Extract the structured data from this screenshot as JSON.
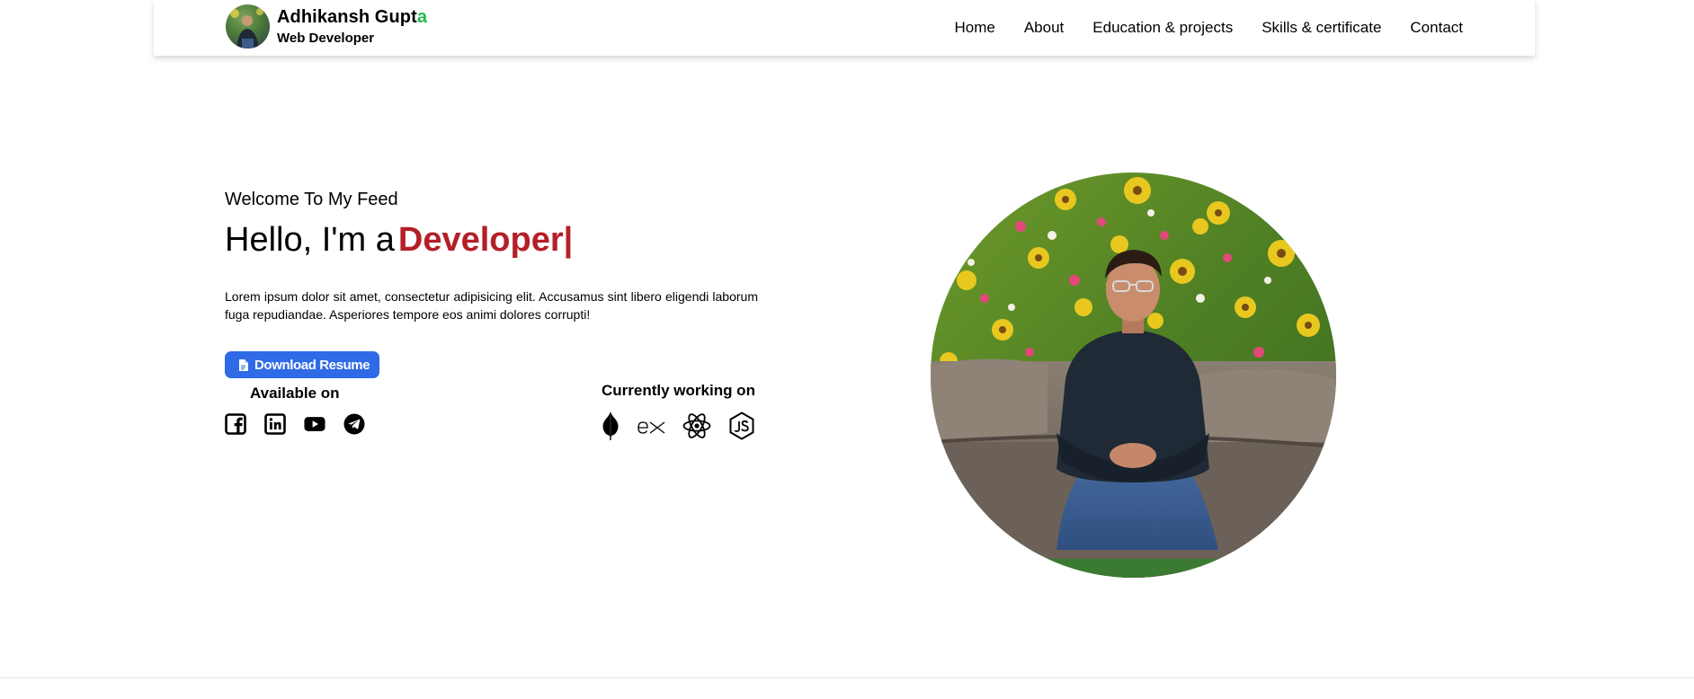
{
  "brand": {
    "name_main": "Adhikansh Gupt",
    "name_accent": "a",
    "role": "Web Developer",
    "accent_color": "#1fba4f"
  },
  "nav": {
    "items": [
      "Home",
      "About",
      "Education & projects",
      "Skills & certificate",
      "Contact"
    ]
  },
  "hero": {
    "welcome": "Welcome To My Feed",
    "headline_prefix": "Hello, I'm a",
    "headline_typed": "Developer",
    "cursor": "|",
    "typed_color": "#b51f27",
    "intro": "Lorem ipsum dolor sit amet, consectetur adipisicing elit. Accusamus sint libero eligendi laborum fuga repudiandae. Asperiores tempore eos animi dolores corrupti!",
    "resume_button": "Download Resume",
    "resume_button_color": "#2f6be6",
    "resume_icon": "document-icon"
  },
  "available": {
    "label": "Available on",
    "icons": [
      "facebook-icon",
      "linkedin-icon",
      "youtube-icon",
      "telegram-icon"
    ]
  },
  "working": {
    "label": "Currently working on",
    "icons": [
      "mongodb-icon",
      "express-icon",
      "react-icon",
      "nodejs-icon"
    ]
  }
}
